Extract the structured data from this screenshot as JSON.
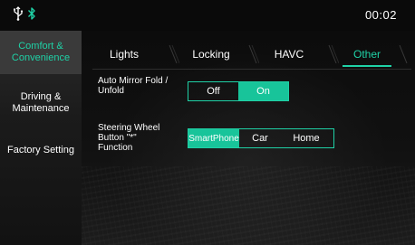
{
  "status_bar": {
    "usb_icon": "usb-icon",
    "bluetooth_icon": "bluetooth-icon",
    "time": "00:02"
  },
  "sidebar": {
    "items": [
      {
        "label": "Comfort & Convenience",
        "active": true
      },
      {
        "label": "Driving & Maintenance",
        "active": false
      },
      {
        "label": "Factory Setting",
        "active": false
      }
    ]
  },
  "tabs": [
    {
      "label": "Lights",
      "active": false
    },
    {
      "label": "Locking",
      "active": false
    },
    {
      "label": "HAVC",
      "active": false
    },
    {
      "label": "Other",
      "active": true
    }
  ],
  "settings": {
    "mirror": {
      "label_line1": "Auto Mirror Fold /",
      "label_line2": "Unfold",
      "options": [
        "Off",
        "On"
      ],
      "selected": "On"
    },
    "steering": {
      "label_line1": "Steering Wheel",
      "label_line2": "Button \"*\"",
      "label_line3": "Function",
      "options": [
        "SmartPhone",
        "Car",
        "Home"
      ],
      "selected": "SmartPhone"
    }
  },
  "colors": {
    "accent": "#1fd1a6",
    "selected_fill": "#18c49a",
    "sidebar_active_bg": "#3a3a3a"
  }
}
